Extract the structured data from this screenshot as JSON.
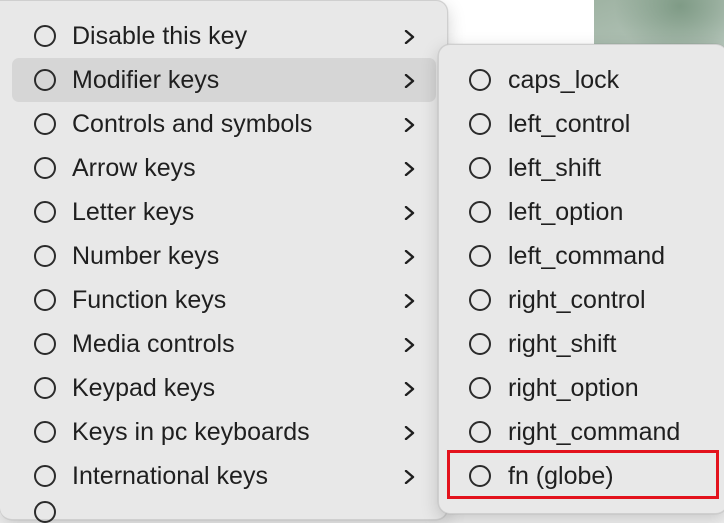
{
  "main_menu": {
    "items": [
      {
        "label": "Disable this key"
      },
      {
        "label": "Modifier keys",
        "highlighted": true
      },
      {
        "label": "Controls and symbols"
      },
      {
        "label": "Arrow keys"
      },
      {
        "label": "Letter keys"
      },
      {
        "label": "Number keys"
      },
      {
        "label": "Function keys"
      },
      {
        "label": "Media controls"
      },
      {
        "label": "Keypad keys"
      },
      {
        "label": "Keys in pc keyboards"
      },
      {
        "label": "International keys"
      }
    ]
  },
  "submenu": {
    "items": [
      {
        "label": "caps_lock"
      },
      {
        "label": "left_control"
      },
      {
        "label": "left_shift"
      },
      {
        "label": "left_option"
      },
      {
        "label": "left_command"
      },
      {
        "label": "right_control"
      },
      {
        "label": "right_shift"
      },
      {
        "label": "right_option"
      },
      {
        "label": "right_command"
      },
      {
        "label": "fn (globe)",
        "annotated": true
      }
    ]
  },
  "colors": {
    "menu_background": "#e8e8e8",
    "highlight": "#d6d6d6",
    "annotation_red": "#e3121c"
  },
  "icons": {
    "radio": "radio-unchecked-icon",
    "chevron": "chevron-right-icon"
  }
}
